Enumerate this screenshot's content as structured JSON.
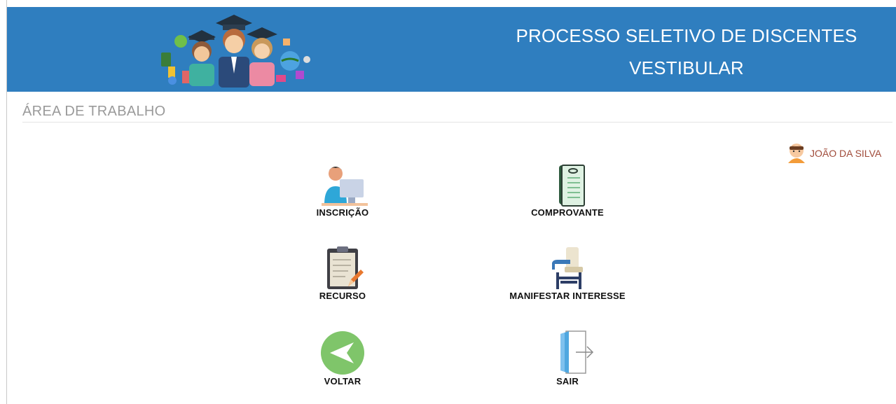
{
  "header": {
    "title_line1": "PROCESSO SELETIVO DE DISCENTES",
    "title_line2": "VESTIBULAR",
    "background_color": "#2f7ebf",
    "logo_icon": "graduates-illustration"
  },
  "workspace": {
    "title": "ÁREA DE TRABALHO"
  },
  "user": {
    "name": "JOÃO DA SILVA",
    "icon": "user-avatar-icon"
  },
  "menu": [
    {
      "label": "INSCRIÇÃO",
      "icon": "student-computer-icon"
    },
    {
      "label": "COMPROVANTE",
      "icon": "receipt-scroll-icon"
    },
    {
      "label": "RECURSO",
      "icon": "clipboard-pencil-icon"
    },
    {
      "label": "MANIFESTAR INTERESSE",
      "icon": "school-desk-icon"
    },
    {
      "label": "VOLTAR",
      "icon": "back-arrow-icon"
    },
    {
      "label": "SAIR",
      "icon": "exit-door-icon"
    }
  ]
}
